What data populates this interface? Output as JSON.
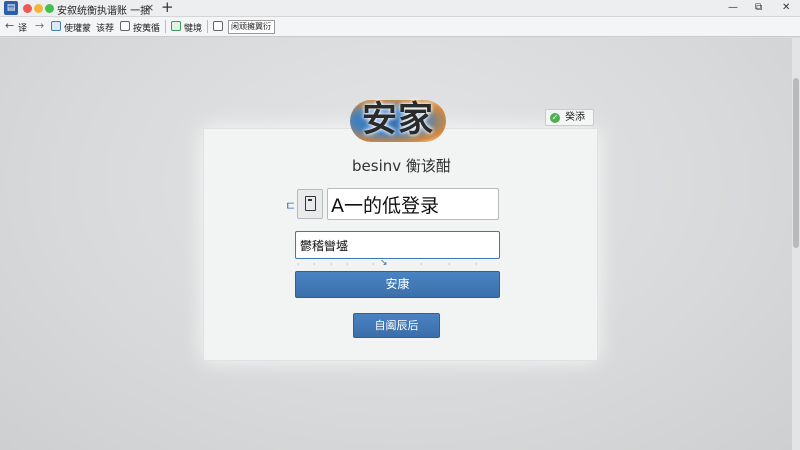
{
  "window": {
    "tab_title": "安叙统衡执谐账 一捆",
    "tab_close": "×",
    "new_tab": "+",
    "app_icon": "doc-icon",
    "controls": {
      "minimize": "—",
      "maximize": "⧉",
      "close": "✕"
    }
  },
  "toolbar": {
    "back_icon": "←",
    "back_label": "译",
    "forward_icon": "→",
    "item1_label": "使瓘蒙",
    "item2_label": "该荐",
    "item3_label": "按荑循",
    "item4_label": "犍境",
    "field_value": "闲顽擁翼衍"
  },
  "badge": {
    "icon": "✓",
    "label": "癸添"
  },
  "login": {
    "logo_text": "安家",
    "subtitle": "besinv 衡该酣",
    "side_mark": "ㄷ",
    "username_value": "A一的低登录",
    "password_value": "鬱稽矕墭",
    "submit_label": "安康",
    "secondary_label": "自阖辰后"
  },
  "colors": {
    "accent": "#3f78b8",
    "button": "#4179b9",
    "badge_green": "#4fae4f"
  }
}
